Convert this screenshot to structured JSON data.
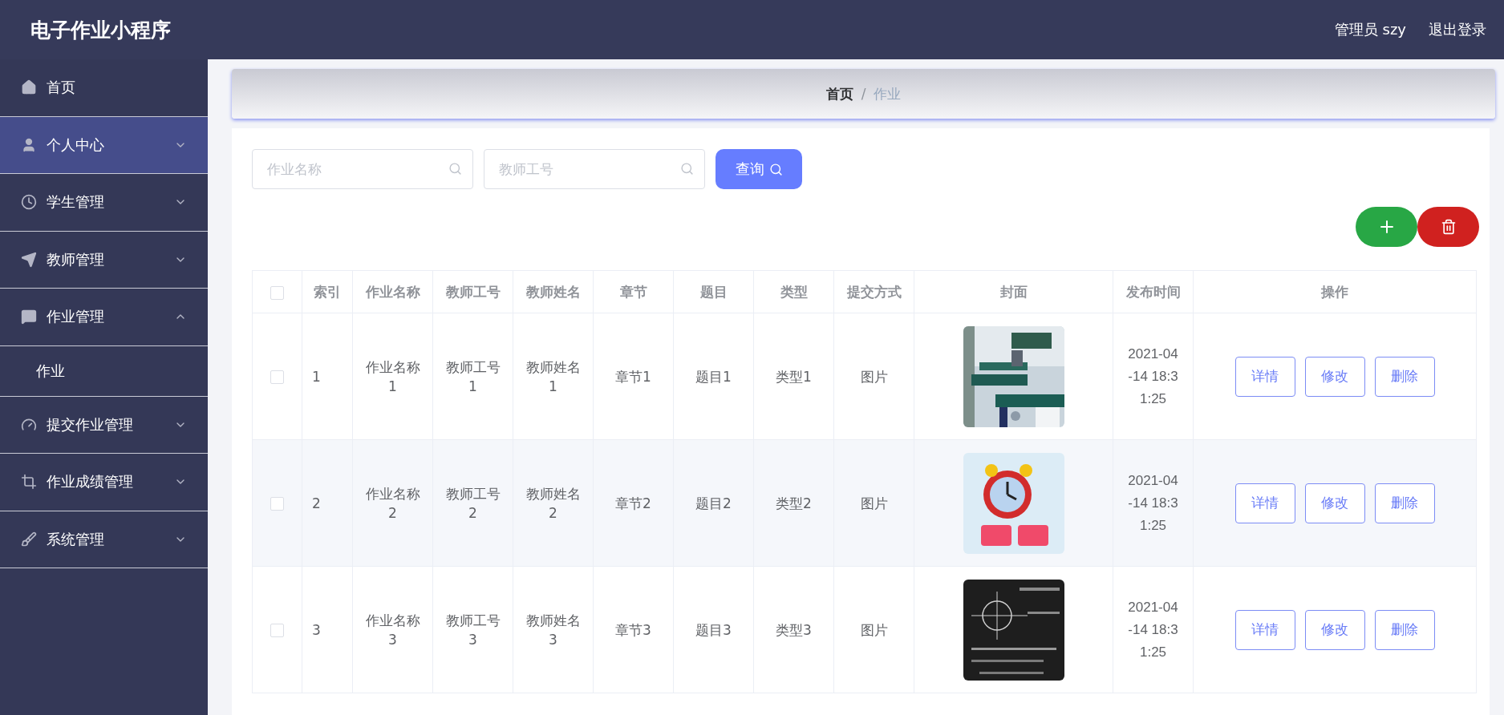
{
  "header": {
    "title": "电子作业小程序",
    "user": "管理员 szy",
    "logout": "退出登录"
  },
  "sidebar": {
    "items": [
      {
        "label": "首页",
        "kind": "link",
        "selected": false
      },
      {
        "label": "个人中心",
        "kind": "group",
        "selected": true,
        "expanded": false
      },
      {
        "label": "学生管理",
        "kind": "group",
        "selected": false,
        "expanded": false
      },
      {
        "label": "教师管理",
        "kind": "group",
        "selected": false,
        "expanded": false
      },
      {
        "label": "作业管理",
        "kind": "group",
        "selected": false,
        "expanded": true,
        "children": [
          {
            "label": "作业",
            "selected": false
          }
        ]
      },
      {
        "label": "提交作业管理",
        "kind": "group",
        "selected": false,
        "expanded": false
      },
      {
        "label": "作业成绩管理",
        "kind": "group",
        "selected": false,
        "expanded": false
      },
      {
        "label": "系统管理",
        "kind": "group",
        "selected": false,
        "expanded": false
      }
    ]
  },
  "breadcrumb": {
    "items": [
      "首页",
      "作业"
    ],
    "separator": "/"
  },
  "search": {
    "fields": [
      {
        "placeholder": "作业名称"
      },
      {
        "placeholder": "教师工号"
      }
    ],
    "button": "查询"
  },
  "table": {
    "columns": [
      "索引",
      "作业名称",
      "教师工号",
      "教师姓名",
      "章节",
      "题目",
      "类型",
      "提交方式",
      "封面",
      "发布时间",
      "操作"
    ],
    "header_checked": false,
    "rows": [
      {
        "checked": false,
        "cells": [
          "1",
          "作业名称1",
          "教师工号1",
          "教师姓名1",
          "章节1",
          "题目1",
          "类型1",
          "图片"
        ],
        "time": "2021-04-14 18:31:25",
        "actions": [
          "详情",
          "修改",
          "删除"
        ]
      },
      {
        "checked": false,
        "cells": [
          "2",
          "作业名称2",
          "教师工号2",
          "教师姓名2",
          "章节2",
          "题目2",
          "类型2",
          "图片"
        ],
        "time": "2021-04-14 18:31:25",
        "actions": [
          "详情",
          "修改",
          "删除"
        ]
      },
      {
        "checked": false,
        "cells": [
          "3",
          "作业名称3",
          "教师工号3",
          "教师姓名3",
          "章节3",
          "题目3",
          "类型3",
          "图片"
        ],
        "time": "2021-04-14 18:31:25",
        "actions": [
          "详情",
          "修改",
          "删除"
        ]
      }
    ]
  }
}
